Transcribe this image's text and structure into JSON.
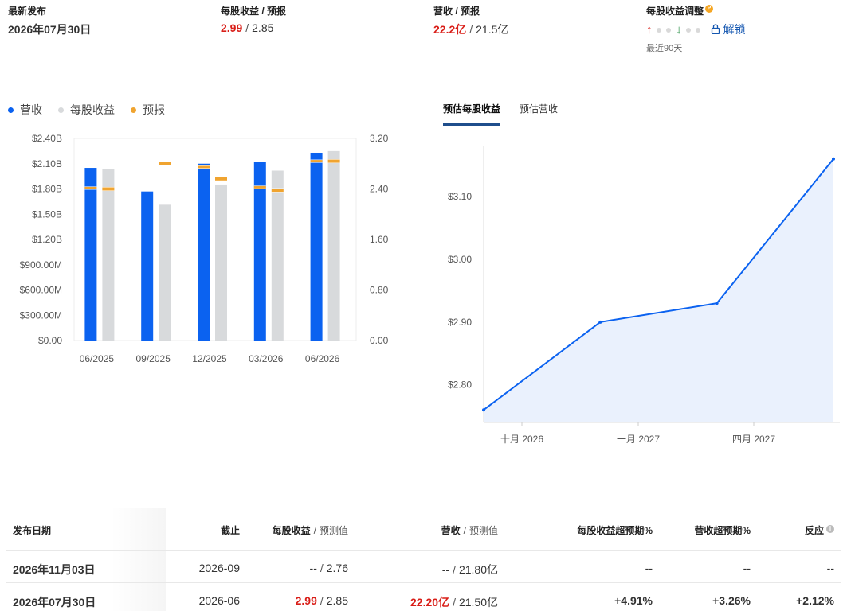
{
  "summary": {
    "latest": {
      "label": "最新发布",
      "value": "2026年07月30日"
    },
    "eps": {
      "label": "每股收益 / 预报",
      "actual": "2.99",
      "sep": "/",
      "estimate": "2.85"
    },
    "revenue": {
      "label": "营收 / 预报",
      "actual": "22.2亿",
      "sep": "/",
      "estimate": "21.5亿"
    },
    "revisions": {
      "label": "每股收益调整",
      "badge": "P",
      "up_arrow": "↑",
      "down_arrow": "↓",
      "unlock_label": "解锁",
      "period": "最近90天"
    }
  },
  "legend": [
    {
      "label": "营收",
      "color": "#0b62f0"
    },
    {
      "label": "每股收益",
      "color": "#d8dadc"
    },
    {
      "label": "预报",
      "color": "#f0a430"
    }
  ],
  "tabs": [
    {
      "label": "预估每股收益",
      "active": true
    },
    {
      "label": "预估营收",
      "active": false
    }
  ],
  "chart_data": [
    {
      "type": "bar",
      "categories": [
        "06/2025",
        "09/2025",
        "12/2025",
        "03/2026",
        "06/2026"
      ],
      "left_axis_ticks": [
        "$0.00",
        "$300.00M",
        "$600.00M",
        "$900.00M",
        "$1.20B",
        "$1.50B",
        "$1.80B",
        "$2.10B",
        "$2.40B"
      ],
      "right_axis_ticks": [
        "0.00",
        "0.80",
        "1.60",
        "2.40",
        "3.20"
      ],
      "ylim_left": [
        0,
        2.4
      ],
      "ylim_right": [
        0,
        3.2
      ],
      "series": [
        {
          "name": "营收",
          "axis": "left",
          "values": [
            2.05,
            1.77,
            2.1,
            2.12,
            2.23
          ],
          "estimates": [
            1.81,
            null,
            2.06,
            1.82,
            2.13
          ],
          "color": "#0b62f0"
        },
        {
          "name": "每股收益",
          "axis": "right",
          "values": [
            2.72,
            2.15,
            2.47,
            2.69,
            3.0
          ],
          "estimates": [
            2.4,
            2.8,
            2.56,
            2.38,
            2.84
          ],
          "color": "#d8dadc"
        }
      ],
      "estimate_color": "#f0a430"
    },
    {
      "type": "area",
      "x": [
        "2026-09",
        "2026-12",
        "2027-03",
        "2027-06"
      ],
      "x_tick_labels": [
        "十月 2026",
        "一月 2027",
        "四月 2027"
      ],
      "values": [
        2.76,
        2.9,
        2.93,
        3.16
      ],
      "y_ticks": [
        "$2.80",
        "$2.90",
        "$3.00",
        "$3.10"
      ],
      "ylim": [
        2.74,
        3.18
      ],
      "line_color": "#0b62f0",
      "fill_color": "#eaf1fd"
    }
  ],
  "table": {
    "headers": {
      "date": "发布日期",
      "period": "截止",
      "eps_main": "每股收益",
      "eps_sep": "/",
      "eps_sub": "预测值",
      "rev_main": "营收",
      "rev_sep": "/",
      "rev_sub": "预测值",
      "eps_beat": "每股收益超预期%",
      "rev_beat": "营收超预期%",
      "reaction": "反应"
    },
    "rows": [
      {
        "date": "2026年11月03日",
        "period": "2026-09",
        "eps_actual": "--",
        "eps_sep": "/",
        "eps_estimate": "2.76",
        "rev_actual": "--",
        "rev_sep": "/",
        "rev_estimate": "21.80亿",
        "eps_beat": "--",
        "rev_beat": "--",
        "reaction": "--"
      },
      {
        "date": "2026年07月30日",
        "period": "2026-06",
        "eps_actual": "2.99",
        "eps_sep": "/",
        "eps_estimate": "2.85",
        "rev_actual": "22.20亿",
        "rev_sep": "/",
        "rev_estimate": "21.50亿",
        "eps_beat": "+4.91%",
        "rev_beat": "+3.26%",
        "reaction": "+2.12%"
      }
    ]
  }
}
